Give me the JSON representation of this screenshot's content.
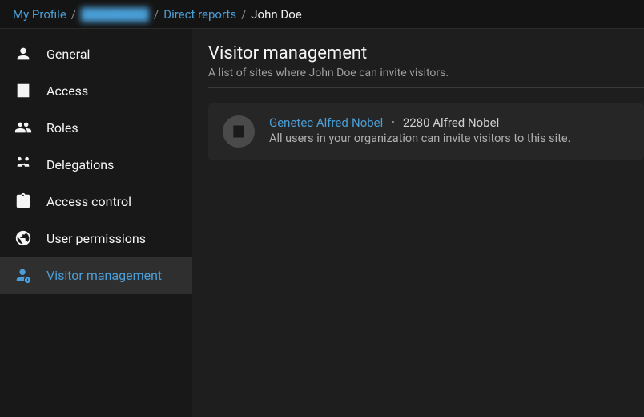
{
  "breadcrumb": {
    "item0": "My Profile",
    "item1": "████████",
    "item2": "Direct reports",
    "item3": "John Doe"
  },
  "sidebar": {
    "items": [
      {
        "label": "General"
      },
      {
        "label": "Access"
      },
      {
        "label": "Roles"
      },
      {
        "label": "Delegations"
      },
      {
        "label": "Access control"
      },
      {
        "label": "User permissions"
      },
      {
        "label": "Visitor management"
      }
    ]
  },
  "page": {
    "title": "Visitor management",
    "subtitle": "A list of sites where John Doe can invite visitors."
  },
  "site": {
    "name": "Genetec Alfred-Nobel",
    "address": "2280 Alfred Nobel",
    "description": "All users in your organization can invite visitors to this site."
  }
}
